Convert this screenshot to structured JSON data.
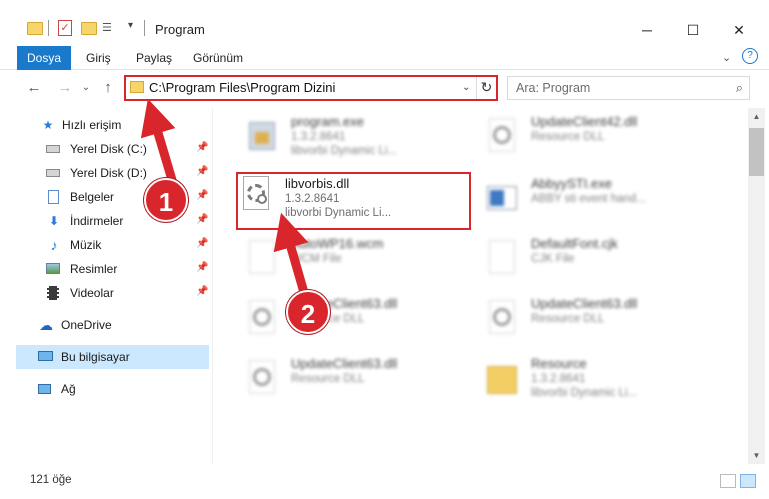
{
  "window": {
    "title": "Program",
    "controls": {
      "minimize": "─",
      "maximize": "☐",
      "close": "✕"
    }
  },
  "ribbon": {
    "tabs": [
      "Dosya",
      "Giriş",
      "Paylaş",
      "Görünüm"
    ],
    "expand": "⌄",
    "help": "?"
  },
  "nav": {
    "back": "←",
    "forward": "→",
    "recent": "⌄",
    "up": "↑"
  },
  "address": {
    "path": "C:\\Program Files\\Program Dizini",
    "dropdown": "⌄",
    "refresh": "↻"
  },
  "search": {
    "placeholder": "Ara: Program",
    "icon": "search-icon"
  },
  "sidebar": {
    "items": [
      {
        "label": "Hızlı erişim",
        "icon": "star-icon",
        "pinned": false
      },
      {
        "label": "Yerel Disk (C:)",
        "icon": "drive-icon",
        "pinned": true
      },
      {
        "label": "Yerel Disk (D:)",
        "icon": "drive-icon",
        "pinned": true
      },
      {
        "label": "Belgeler",
        "icon": "documents-icon",
        "pinned": true
      },
      {
        "label": "İndirmeler",
        "icon": "download-icon",
        "pinned": true
      },
      {
        "label": "Müzik",
        "icon": "music-icon",
        "pinned": true
      },
      {
        "label": "Resimler",
        "icon": "pictures-icon",
        "pinned": true
      },
      {
        "label": "Videolar",
        "icon": "video-icon",
        "pinned": true
      },
      {
        "label": "OneDrive",
        "icon": "cloud-icon",
        "pinned": false
      },
      {
        "label": "Bu bilgisayar",
        "icon": "computer-icon",
        "pinned": false,
        "selected": true
      },
      {
        "label": "Ağ",
        "icon": "network-icon",
        "pinned": false
      }
    ]
  },
  "files": [
    {
      "name": "program.exe",
      "line2": "1.3.2.8641",
      "line3": "libvorbi Dynamic Li...",
      "icon": "exe-icon",
      "blurred": true
    },
    {
      "name": "UpdateClient42.dll",
      "line2": "Resource DLL",
      "line3": "",
      "icon": "dll-icon",
      "blurred": true
    },
    {
      "name": "libvorbis.dll",
      "line2": "1.3.2.8641",
      "line3": "libvorbi Dynamic Li...",
      "icon": "dll-gear-icon",
      "blurred": false,
      "highlighted": true
    },
    {
      "name": "AbbyySTI.exe",
      "line2": "ABBY sti event hand...",
      "line3": "",
      "icon": "app-window-icon",
      "blurred": true
    },
    {
      "name": "AutoWP16.wcm",
      "line2": "WCM File",
      "line3": "",
      "icon": "blank-file-icon",
      "blurred": true
    },
    {
      "name": "DefaultFont.cjk",
      "line2": "CJK File",
      "line3": "",
      "icon": "blank-file-icon",
      "blurred": true
    },
    {
      "name": "UpdateClient63.dll",
      "line2": "Resource DLL",
      "line3": "",
      "icon": "dll-icon",
      "blurred": true
    },
    {
      "name": "UpdateClient63.dll",
      "line2": "Resource DLL",
      "line3": "",
      "icon": "dll-icon",
      "blurred": true
    },
    {
      "name": "UpdateClient63.dll",
      "line2": "Resource DLL",
      "line3": "",
      "icon": "dll-icon",
      "blurred": true
    },
    {
      "name": "Resource",
      "line2": "1.3.2.8641",
      "line3": "libvorbi Dynamic Li...",
      "icon": "folder-icon",
      "blurred": true
    }
  ],
  "status": {
    "count": "121 öğe"
  },
  "annotations": {
    "step1": "1",
    "step2": "2",
    "color": "#d9262c"
  }
}
